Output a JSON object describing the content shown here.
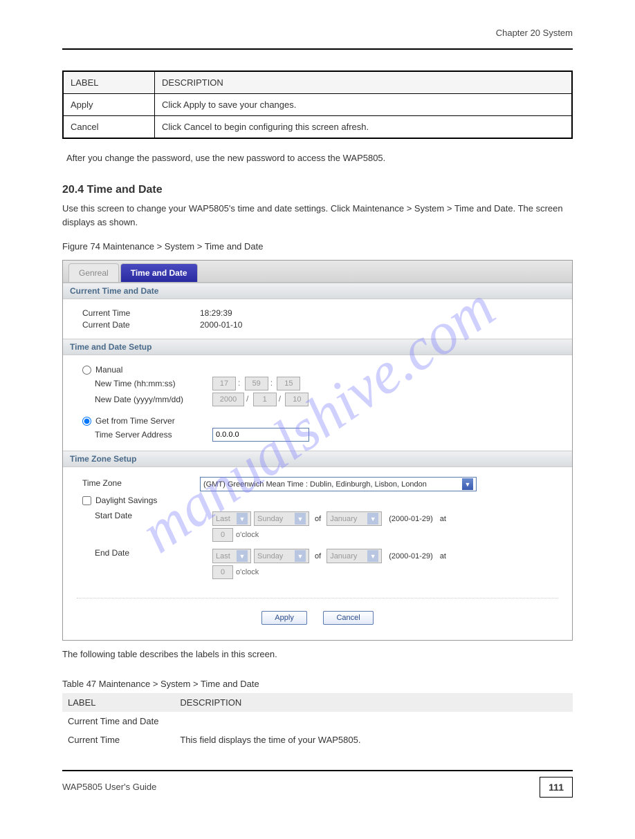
{
  "header": {
    "right": "Chapter 20 System"
  },
  "param_table": {
    "headers": [
      "LABEL",
      "DESCRIPTION"
    ],
    "rows": [
      {
        "label": "Apply",
        "desc": "Click Apply to save your changes."
      },
      {
        "label": "Cancel",
        "desc": "Click Cancel to begin configuring this screen afresh."
      }
    ]
  },
  "note_symbol": "",
  "note_text": "After you change the password, use the new password to access the WAP5805.",
  "section_heading": "20.4  Time and Date",
  "section_intro": "Use this screen to change your WAP5805's time and date settings. Click Maintenance > System > Time and Date. The screen displays as shown.",
  "figure_caption": "Figure 74   Maintenance > System > Time and Date",
  "tabs": {
    "inactive": "Genreal",
    "active": "Time and Date"
  },
  "panel": {
    "current": {
      "title": "Current Time and Date",
      "time_label": "Current Time",
      "time_value": "18:29:39",
      "date_label": "Current Date",
      "date_value": "2000-01-10"
    },
    "setup": {
      "title": "Time and Date Setup",
      "manual_label": "Manual",
      "new_time_label": "New Time (hh:mm:ss)",
      "new_time_hh": "17",
      "new_time_mm": "59",
      "new_time_ss": "15",
      "new_date_label": "New Date (yyyy/mm/dd)",
      "new_date_y": "2000",
      "new_date_m": "1",
      "new_date_d": "10",
      "server_label": "Get from Time Server",
      "server_addr_label": "Time Server Address",
      "server_addr_value": "0.0.0.0"
    },
    "tz": {
      "title": "Time Zone Setup",
      "tz_label": "Time Zone",
      "tz_value": "(GMT) Greenwich Mean Time : Dublin, Edinburgh, Lisbon, London",
      "dst_label": "Daylight Savings",
      "start_label": "Start Date",
      "end_label": "End Date",
      "sel_last": "Last",
      "sel_sunday": "Sunday",
      "sel_january": "January",
      "of": "of",
      "at": "at",
      "date_hint_start": "(2000-01-29)",
      "date_hint_end": "(2000-01-29)",
      "oclock_num": "0",
      "oclock": "o'clock"
    },
    "buttons": {
      "apply": "Apply",
      "cancel": "Cancel"
    }
  },
  "post_figure": {
    "intro": "The following table describes the labels in this screen.",
    "caption": "Table 47   Maintenance > System > Time and Date",
    "header1": "LABEL",
    "header2": "DESCRIPTION",
    "group": "Current Time and Date",
    "row1_label": "Current Time",
    "row1_desc": "This field displays the time of your WAP5805."
  },
  "footer": {
    "left": "WAP5805 User's Guide",
    "page": "111"
  },
  "watermark": "manualshive.com"
}
